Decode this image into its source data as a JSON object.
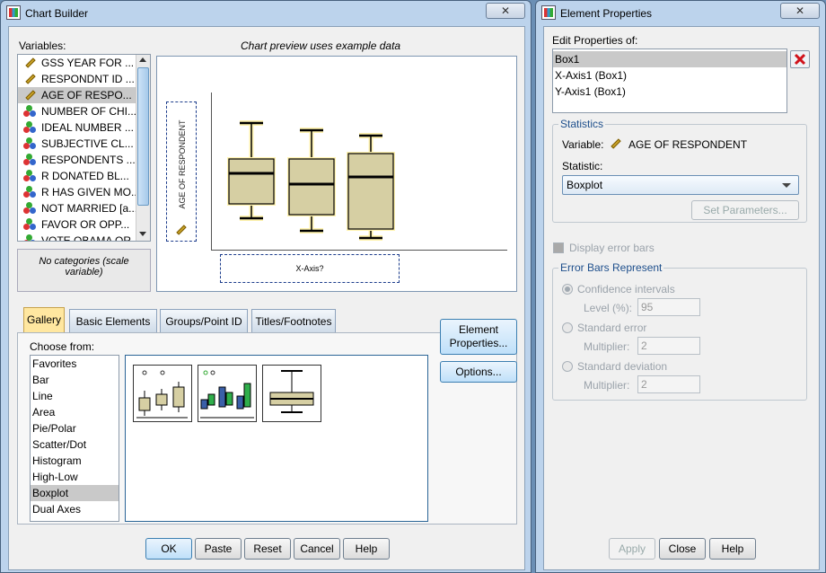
{
  "chart_builder": {
    "title": "Chart Builder",
    "close_glyph": "✕",
    "variables_label": "Variables:",
    "preview_note": "Chart preview uses example data",
    "variables": [
      {
        "label": "GSS YEAR FOR ...",
        "icon": "scale-ruler-icon"
      },
      {
        "label": "RESPONDNT ID ...",
        "icon": "scale-ruler-icon"
      },
      {
        "label": "AGE OF RESPO...",
        "icon": "scale-ruler-icon",
        "selected": true
      },
      {
        "label": "NUMBER OF CHI...",
        "icon": "nominal-icon"
      },
      {
        "label": "IDEAL NUMBER ...",
        "icon": "nominal-icon"
      },
      {
        "label": "SUBJECTIVE CL...",
        "icon": "nominal-icon"
      },
      {
        "label": "RESPONDENTS ...",
        "icon": "nominal-icon"
      },
      {
        "label": "R DONATED BL...",
        "icon": "nominal-icon"
      },
      {
        "label": "R HAS GIVEN MO...",
        "icon": "nominal-icon"
      },
      {
        "label": "NOT MARRIED [a...",
        "icon": "nominal-icon"
      },
      {
        "label": "FAVOR OR OPP...",
        "icon": "nominal-icon"
      },
      {
        "label": "VOTE OBAMA OR ...",
        "icon": "nominal-icon"
      }
    ],
    "no_categories": "No categories (scale variable)",
    "y_axis_label": "AGE OF RESPONDENT",
    "x_axis_label": "X-Axis?",
    "tabs": [
      "Gallery",
      "Basic Elements",
      "Groups/Point ID",
      "Titles/Footnotes"
    ],
    "choose_from_label": "Choose from:",
    "chart_types": [
      "Favorites",
      "Bar",
      "Line",
      "Area",
      "Pie/Polar",
      "Scatter/Dot",
      "Histogram",
      "High-Low",
      "Boxplot",
      "Dual Axes"
    ],
    "selected_chart_type": "Boxplot",
    "element_properties_button": "Element Properties...",
    "options_button": "Options...",
    "ok_button": "OK",
    "paste_button": "Paste",
    "reset_button": "Reset",
    "cancel_button": "Cancel",
    "help_button": "Help"
  },
  "element_properties": {
    "title": "Element Properties",
    "close_glyph": "✕",
    "edit_label": "Edit Properties of:",
    "elements": [
      "Box1",
      "X-Axis1 (Box1)",
      "Y-Axis1 (Box1)"
    ],
    "statistics_title": "Statistics",
    "variable_label": "Variable:",
    "variable_value": "AGE OF RESPONDENT",
    "statistic_label": "Statistic:",
    "statistic_value": "Boxplot",
    "set_parameters_button": "Set Parameters...",
    "display_error_bars": "Display error bars",
    "error_bars_title": "Error Bars Represent",
    "confidence_intervals": "Confidence intervals",
    "level_label": "Level (%):",
    "level_value": "95",
    "standard_error": "Standard error",
    "multiplier_label": "Multiplier:",
    "se_multiplier": "2",
    "standard_deviation": "Standard deviation",
    "sd_multiplier": "2",
    "apply_button": "Apply",
    "close_button": "Close",
    "help_button": "Help"
  }
}
